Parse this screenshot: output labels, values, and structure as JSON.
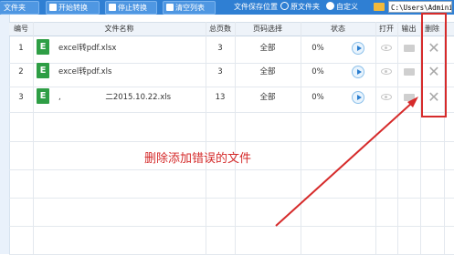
{
  "toolbar": {
    "add_file_label": "文件夹",
    "start_label": "开始转换",
    "stop_label": "停止转换",
    "clear_label": "清空列表",
    "save_location_label": "文件保存位置",
    "option_original": "原文件夹",
    "option_custom": "自定义",
    "selected_option": "自定义",
    "path_value": "C:\\Users\\Adminis"
  },
  "table": {
    "columns": [
      "编号",
      "文件名称",
      "总页数",
      "页码选择",
      "状态",
      "打开",
      "输出",
      "删除"
    ],
    "rows": [
      {
        "index": "1",
        "name": "excel转pdf.xlsx",
        "pages": "3",
        "range": "全部",
        "status": "0%"
      },
      {
        "index": "2",
        "name": "excel转pdf.xls",
        "pages": "3",
        "range": "全部",
        "status": "0%"
      },
      {
        "index": "3",
        "name": ",                  二2015.10.22.xls",
        "pages": "13",
        "range": "全部",
        "status": "0%"
      }
    ]
  },
  "annotation": {
    "text": "删除添加错误的文件",
    "color": "#d42a2a"
  },
  "icons": {
    "file": "excel-file-icon",
    "convert": "play-icon",
    "open": "eye-icon",
    "output": "folder-icon",
    "delete": "close-icon"
  }
}
